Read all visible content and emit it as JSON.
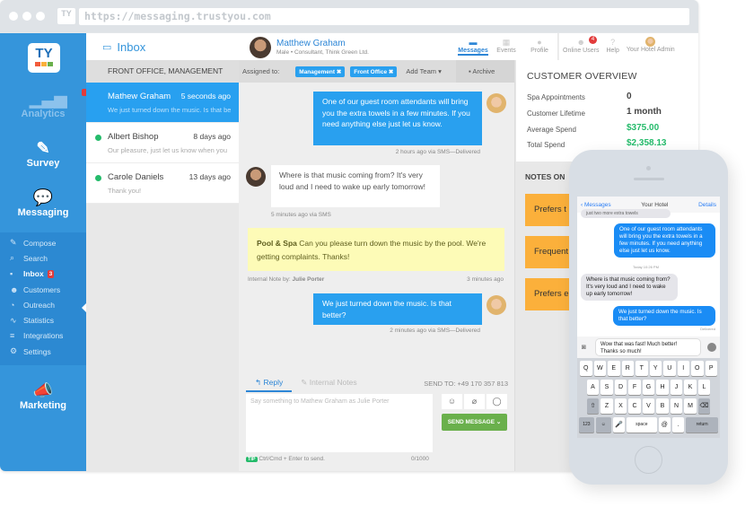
{
  "browser": {
    "url": "https://messaging.trustyou.com",
    "favicon": "TY"
  },
  "brand": {
    "logo_text": "TY",
    "accent": "#3595db",
    "logo_squares": [
      "#f25c3c",
      "#fbb03b",
      "#6ab04c"
    ]
  },
  "sidebar": {
    "modules": [
      {
        "label": "Analytics",
        "icon": "analytics-icon",
        "locked": true
      },
      {
        "label": "Survey",
        "icon": "survey-icon"
      },
      {
        "label": "Messaging",
        "icon": "messaging-icon"
      },
      {
        "label": "Marketing",
        "icon": "megaphone-icon"
      }
    ],
    "items": [
      {
        "label": "Compose",
        "icon": "✎"
      },
      {
        "label": "Search",
        "icon": "⌕"
      },
      {
        "label": "Inbox",
        "icon": "▪",
        "badge": "3"
      },
      {
        "label": "Customers",
        "icon": "☻"
      },
      {
        "label": "Outreach",
        "icon": "◔"
      },
      {
        "label": "Statistics",
        "icon": "∿"
      },
      {
        "label": "Integrations",
        "icon": "≡"
      },
      {
        "label": "Settings",
        "icon": "⚙"
      }
    ]
  },
  "inbox": {
    "title": "Inbox",
    "filter": "FRONT OFFICE, MANAGEMENT",
    "conversations": [
      {
        "name": "Mathew Graham",
        "time": "5 seconds ago",
        "preview": "We just turned down the music. Is that be..."
      },
      {
        "name": "Albert Bishop",
        "time": "8 days ago",
        "preview": "Our pleasure, just let us know when you"
      },
      {
        "name": "Carole Daniels",
        "time": "13 days ago",
        "preview": "Thank you!"
      }
    ]
  },
  "chat": {
    "contact_name": "Matthew Graham",
    "contact_sub": "Male • Consultant, Think Green Ltd.",
    "assigned_label": "Assigned to:",
    "tags": [
      "Management ✖",
      "Front Office ✖"
    ],
    "add_team": "Add Team ▾",
    "archive": "Archive",
    "messages": [
      {
        "text": "One of our guest room attendants will bring you the extra towels in a few minutes. If you need anything else just let us know.",
        "meta": "2 hours ago via SMS—Delivered"
      },
      {
        "text": "Where is that music coming from? It's very loud and I need to wake up early tomorrow!",
        "meta": "5 minutes ago via SMS"
      },
      {
        "text": "We just turned down the music. Is that better?",
        "meta": "2 minutes ago via SMS—Delivered"
      }
    ],
    "note": {
      "team": "Pool & Spa",
      "text": "Can you please turn down the music by the pool. We're getting complaints. Thanks!",
      "author_label": "Internal Note by:",
      "author": "Julie Porter",
      "time": "3 minutes ago"
    },
    "reply": {
      "tab_reply": "Reply",
      "tab_notes": "Internal Notes",
      "send_to": "SEND TO: +49 170 357 813",
      "placeholder": "Say something to Mathew Graham as Julie Porter",
      "tip_badge": "TIP",
      "tip": "Ctrl/Cmd + Enter to send.",
      "count": "0/1000",
      "send_button": "SEND MESSAGE ⌄"
    }
  },
  "topnav": {
    "tabs": [
      {
        "label": "Messages",
        "icon": "▬"
      },
      {
        "label": "Events",
        "icon": "▦"
      },
      {
        "label": "Profile",
        "icon": "●"
      }
    ],
    "online_users": "Online Users",
    "online_count": "4",
    "help": "Help",
    "admin": "Your Hotel Admin"
  },
  "overview": {
    "title": "CUSTOMER OVERVIEW",
    "rows": [
      {
        "label": "Spa Appointments",
        "value": "0"
      },
      {
        "label": "Customer Lifetime",
        "value": "1 month"
      },
      {
        "label": "Average Spend",
        "value": "$375.00"
      },
      {
        "label": "Total Spend",
        "value": "$2,358.13"
      }
    ],
    "notes_title": "NOTES ON",
    "notes": [
      "Prefers t",
      "Frequent",
      "Prefers e"
    ]
  },
  "phone": {
    "back": "Messages",
    "title": "Your Hotel",
    "details": "Details",
    "messages": [
      {
        "dir": "in",
        "text": "just two more extra towels"
      },
      {
        "dir": "out",
        "text": "One of our guest room attendants will bring you the extra towels in a few minutes. If you need anything else just let us know."
      },
      {
        "dir": "in",
        "text": "Where is that music coming from? It's very loud and I need to wake up early tomorrow!"
      },
      {
        "dir": "out",
        "text": "We just turned down the music. Is that better?"
      }
    ],
    "timestamp": "Today 10:26 PM",
    "delivered": "Delivered",
    "draft": "Wow that was fast! Much better! Thanks so much!",
    "keyboard": {
      "row1": [
        "Q",
        "W",
        "E",
        "R",
        "T",
        "Y",
        "U",
        "I",
        "O",
        "P"
      ],
      "row2": [
        "A",
        "S",
        "D",
        "F",
        "G",
        "H",
        "J",
        "K",
        "L"
      ],
      "row3": [
        "⇧",
        "Z",
        "X",
        "C",
        "V",
        "B",
        "N",
        "M",
        "⌫"
      ],
      "row4": [
        "123",
        "☺",
        "🎤",
        "space",
        "@",
        ".",
        "return"
      ]
    }
  }
}
